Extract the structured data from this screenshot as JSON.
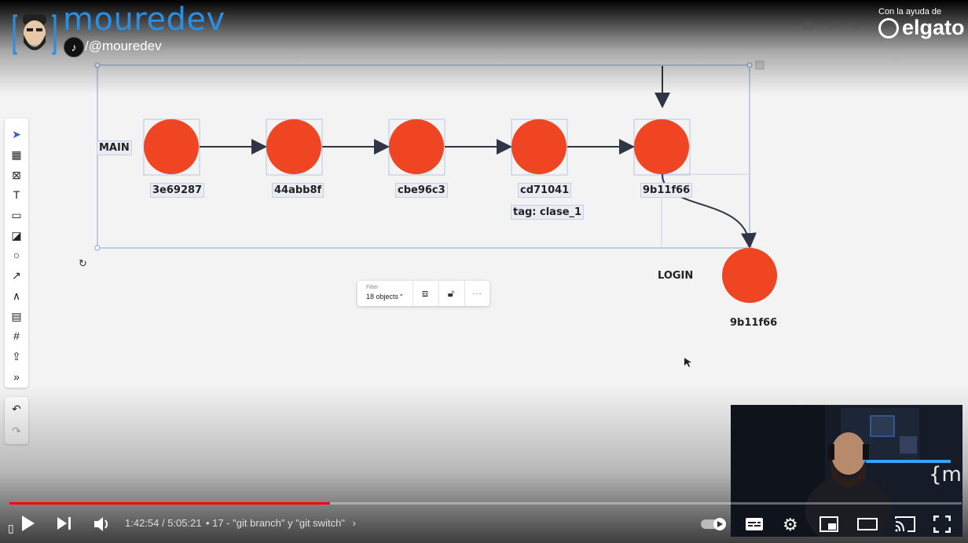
{
  "channel": {
    "logo_text": "mouredev",
    "handle": "/@mouredev",
    "sponsor_prefix": "Con la ayuda de",
    "sponsor_name": "elgato"
  },
  "diagram": {
    "main_label": "MAIN",
    "branch_label": "LOGIN",
    "commits": [
      {
        "hash": "3e69287"
      },
      {
        "hash": "44abb8f"
      },
      {
        "hash": "cbe96c3"
      },
      {
        "hash": "cd71041",
        "tag": "tag: clase_1"
      },
      {
        "hash": "9b11f66"
      }
    ],
    "branch_commit": {
      "hash": "9b11f66"
    },
    "commit_color": "#f04523"
  },
  "selection_toolbar": {
    "filter_label": "Filter",
    "filter_value": "18 objects",
    "icons": [
      "frame-icon",
      "lock-icon",
      "more-icon"
    ]
  },
  "left_toolbar": {
    "icons": [
      "select-icon",
      "template-icon",
      "crop-icon",
      "text-icon",
      "card-icon",
      "sticky-note-icon",
      "shape-icon",
      "arrow-icon",
      "pen-icon",
      "comment-icon",
      "frame-icon",
      "upload-icon",
      "more-tools-icon"
    ],
    "history_icons": [
      "undo-icon",
      "redo-icon"
    ]
  },
  "player": {
    "current_time": "1:42:54",
    "duration": "5:05:21",
    "time_text": "1:42:54 / 5:05:21",
    "chapter": "• 17 - \"git branch\" y \"git switch\"",
    "progress": 0.337,
    "accent_color": "#ff0000",
    "autoplay": true
  },
  "webcam": {
    "brand_mark": "{m}"
  }
}
